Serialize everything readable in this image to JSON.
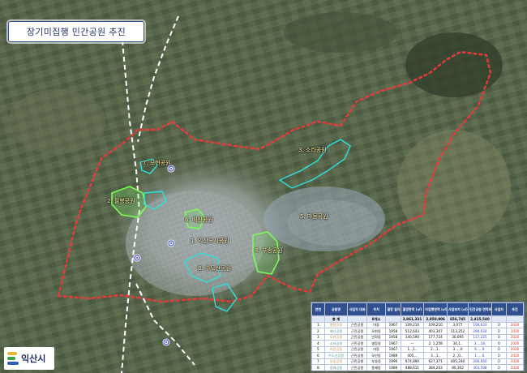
{
  "title": "장기미집행 민간공원 추진",
  "logo": {
    "text": "익산시",
    "icon": "iksan-city-logo"
  },
  "colors": {
    "boundary": "#e83a3a",
    "park_outline": "#2ee0e0",
    "green_area": "#7cfa5a",
    "railway": "#ffffff",
    "station_marker": "#3a4bd8"
  },
  "map_labels": [
    "2. 팔봉공원",
    "3. 소라공원",
    "5. 마동공원",
    "6. 배산공원",
    "7. 모현공원",
    "8. 수도산공원",
    "1. 익산도시공원",
    "4. 부송공원"
  ],
  "table": {
    "headers": [
      "연번",
      "공원명",
      "사업자 대표",
      "위치",
      "결정 일자",
      "결정면적 (㎡)",
      "미집행면적 (㎡)",
      "사업부지 (㎡)",
      "민간공원 면적비율",
      "사업자",
      "추진"
    ],
    "total": [
      "",
      "총 계",
      "",
      "8개소",
      "",
      "3,861,331",
      "2,850,906",
      "656,745",
      "2,415,540",
      "",
      ""
    ],
    "rows": [
      [
        "1",
        "팔봉공원",
        "근린공원",
        "마동",
        "1967",
        "109,210",
        "109,210",
        "3,077",
        "106,633",
        "O",
        "2020"
      ],
      [
        "2",
        "배산공원",
        "근린공원",
        "모현동",
        "1958",
        "512,643",
        "403,307",
        "113,252",
        "290,034",
        "O",
        "2020"
      ],
      [
        "3",
        "모현공원",
        "근린공원",
        "인화동",
        "1958",
        "140,590",
        "177,724",
        "30,695",
        "117,225",
        "O",
        "2020"
      ],
      [
        "4",
        "소라공원",
        "근린공원",
        "영등동",
        "1967",
        "—",
        "2. 1,258",
        "34,1..",
        "3...,18.",
        "O",
        "2020"
      ],
      [
        "5",
        "마동공원",
        "근린공원",
        "마동",
        "1967",
        "1..,1..",
        "2..,1..",
        "3..,..0",
        "6..,..9.",
        "O",
        "2020"
      ],
      [
        "6",
        "수도산공원",
        "근린공원",
        "모인동",
        "1989",
        "405,..",
        "3..,1..",
        "2..,0..",
        "1..,..6.",
        "O",
        "2020"
      ],
      [
        "7",
        "부송공원",
        "근린공원",
        "부송동",
        "1990",
        "974,890",
        "627,371",
        "405,240",
        "266,040",
        "O",
        "2020"
      ],
      [
        "8",
        "용제공원",
        "근린공원",
        "용제동",
        "1989",
        "488,611",
        "384,203",
        "80,302",
        "303,598",
        "O",
        "2020"
      ]
    ]
  }
}
